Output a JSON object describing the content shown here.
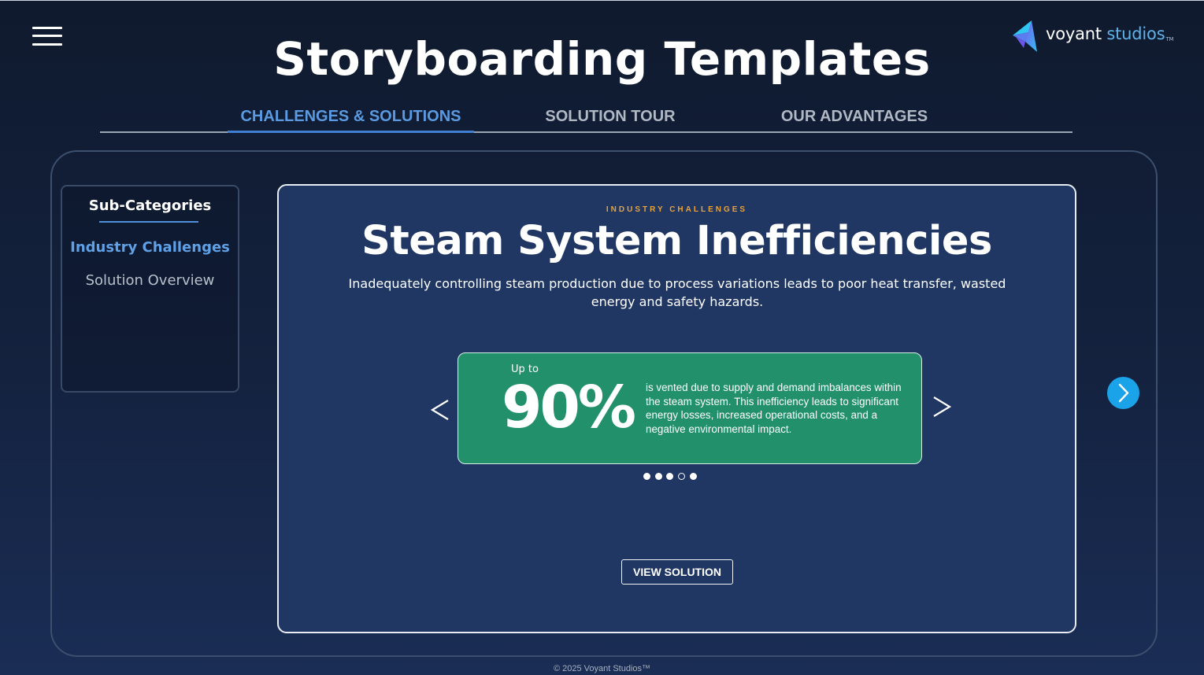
{
  "header": {
    "title": "Storyboarding Templates",
    "menu_icon": "hamburger-menu-icon",
    "logo": {
      "icon": "voyant-logo-mark-icon",
      "word1": "voyant",
      "word2": "studios",
      "tm": "TM"
    }
  },
  "tabs": [
    {
      "label": "CHALLENGES & SOLUTIONS",
      "active": true
    },
    {
      "label": "SOLUTION TOUR",
      "active": false
    },
    {
      "label": "OUR ADVANTAGES",
      "active": false
    }
  ],
  "sidebar": {
    "title": "Sub-Categories",
    "items": [
      {
        "label": "Industry Challenges",
        "active": true
      },
      {
        "label": "Solution Overview",
        "active": false
      }
    ]
  },
  "card": {
    "eyebrow": "INDUSTRY CHALLENGES",
    "title": "Steam System Inefficiencies",
    "description": "Inadequately controlling steam production due to process variations leads to poor heat transfer, wasted energy and safety hazards.",
    "stat": {
      "prefix": "Up to",
      "value": "90%",
      "text": " is vented due to supply and demand imbalances within the steam system. This inefficiency leads to significant energy losses, increased operational costs, and a negative environmental impact."
    },
    "carousel": {
      "prev_icon": "chevron-left-icon",
      "next_icon": "chevron-right-icon",
      "dots": [
        {
          "filled": true
        },
        {
          "filled": true
        },
        {
          "filled": true
        },
        {
          "filled": false
        },
        {
          "filled": true
        }
      ]
    },
    "button_label": "VIEW SOLUTION"
  },
  "next_page_icon": "next-circle-arrow-icon",
  "footer": {
    "copyright": "© 2025 Voyant Studios™"
  },
  "colors": {
    "accent_blue": "#5b9ae0",
    "card_bg": "#203663",
    "stat_green": "#21906b",
    "eyebrow_orange": "#e8a33a",
    "next_button": "#1aa3e8"
  }
}
